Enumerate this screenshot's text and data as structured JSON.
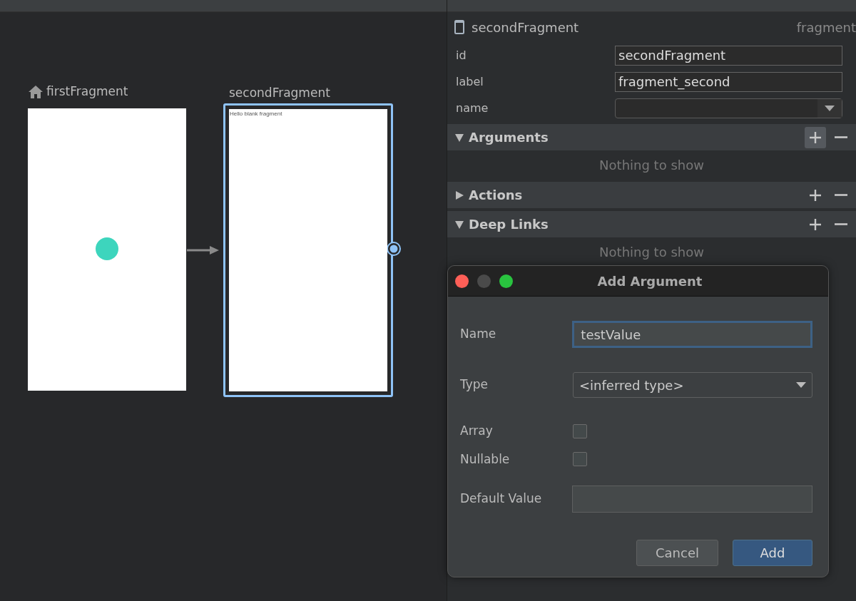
{
  "graph": {
    "destinations": [
      {
        "label": "firstFragment",
        "start": true,
        "selected": false,
        "kind": "placeholder"
      },
      {
        "label": "secondFragment",
        "start": false,
        "selected": true,
        "kind": "layout",
        "preview_text": "Hello blank fragment"
      }
    ]
  },
  "attributes": {
    "title": "secondFragment",
    "type": "fragment",
    "fields": [
      {
        "label": "id",
        "kind": "text",
        "value": "secondFragment"
      },
      {
        "label": "label",
        "kind": "text",
        "value": "fragment_second"
      },
      {
        "label": "name",
        "kind": "dropdown"
      }
    ],
    "sections": [
      {
        "title": "Arguments",
        "expanded": true,
        "add_hovered": true,
        "empty_text": "Nothing to show"
      },
      {
        "title": "Actions",
        "expanded": false,
        "add_hovered": false
      },
      {
        "title": "Deep Links",
        "expanded": true,
        "add_hovered": false,
        "empty_text": "Nothing to show"
      }
    ]
  },
  "dialog": {
    "title": "Add Argument",
    "fields": [
      {
        "label": "Name",
        "kind": "text",
        "value": "testValue",
        "focused": true
      },
      {
        "label": "Type",
        "kind": "dropdown",
        "value": "<inferred type>"
      },
      {
        "label": "Array",
        "kind": "checkbox",
        "checked": false
      },
      {
        "label": "Nullable",
        "kind": "checkbox",
        "checked": false
      },
      {
        "label": "Default Value",
        "kind": "text",
        "focused": false
      }
    ],
    "buttons": [
      {
        "label": "Cancel",
        "default": false
      },
      {
        "label": "Add",
        "default": true
      }
    ]
  }
}
